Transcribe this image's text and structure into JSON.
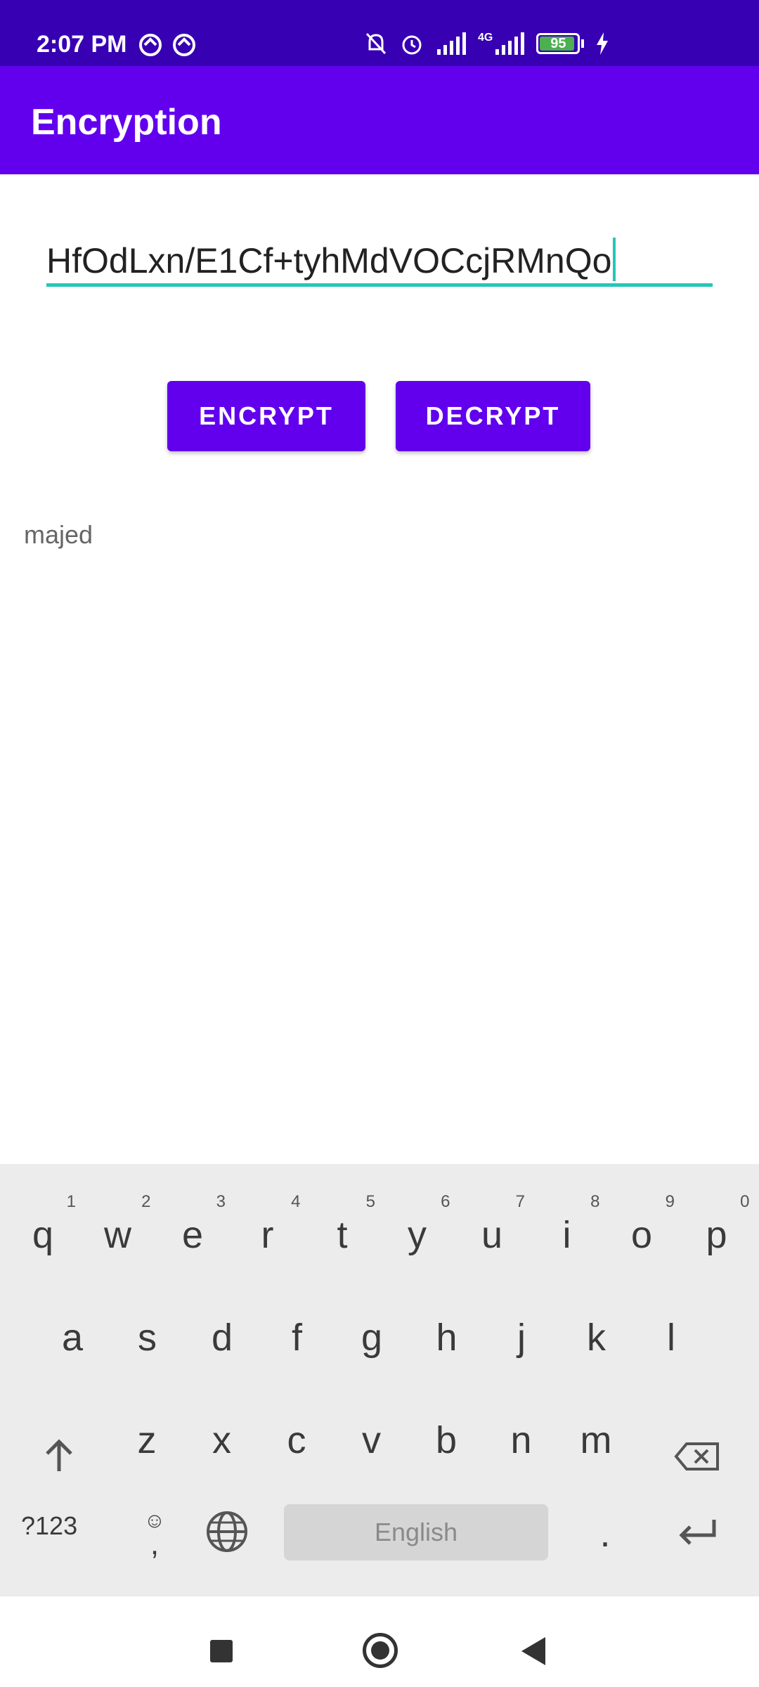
{
  "status_bar": {
    "time": "2:07 PM",
    "network_label": "4G",
    "battery_level": "95",
    "battery_fraction": 0.95,
    "icons": [
      "vpn-icon",
      "vpn-icon",
      "mute-icon",
      "alarm-icon",
      "signal-icon",
      "signal-icon",
      "battery-icon",
      "charging-icon"
    ]
  },
  "app_bar": {
    "title": "Encryption"
  },
  "input": {
    "value": "HfOdLxn/E1Cf+tyhMdVOCcjRMnQo"
  },
  "buttons": {
    "encrypt": "ENCRYPT",
    "decrypt": "DECRYPT"
  },
  "result": {
    "text": "majed"
  },
  "keyboard": {
    "row1": [
      "q",
      "w",
      "e",
      "r",
      "t",
      "y",
      "u",
      "i",
      "o",
      "p"
    ],
    "row1_hints": [
      "1",
      "2",
      "3",
      "4",
      "5",
      "6",
      "7",
      "8",
      "9",
      "0"
    ],
    "row2": [
      "a",
      "s",
      "d",
      "f",
      "g",
      "h",
      "j",
      "k",
      "l"
    ],
    "row3": [
      "z",
      "x",
      "c",
      "v",
      "b",
      "n",
      "m"
    ],
    "symbols": "?123",
    "comma": ",",
    "period": ".",
    "space": "English"
  },
  "colors": {
    "status_bar": "#3700b3",
    "primary": "#6200ee",
    "accent": "#26c6b8"
  }
}
